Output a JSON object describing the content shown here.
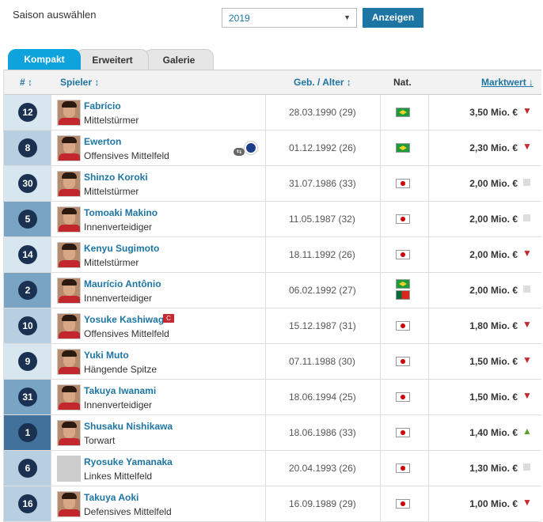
{
  "season": {
    "label": "Saison auswählen",
    "selected": "2019",
    "button": "Anzeigen"
  },
  "tabs": [
    "Kompakt",
    "Erweitert",
    "Galerie"
  ],
  "headers": {
    "num": "# ↕",
    "player": "Spieler ↕",
    "dob": "Geb. / Alter ↕",
    "nat": "Nat.",
    "mv": "Marktwert ↓"
  },
  "colors": {
    "accent": "#1d75a3",
    "tab_active": "#0fa3de",
    "down": "#c5282f",
    "up": "#5aa02c"
  },
  "players": [
    {
      "num": "12",
      "name": "Fabrício",
      "pos": "Mittelstürmer",
      "dob": "28.03.1990 (29)",
      "nat": [
        "br"
      ],
      "mv": "3,50 Mio. €",
      "trend": "down",
      "num_bg": "#d7e6ef"
    },
    {
      "num": "8",
      "name": "Ewerton",
      "pos": "Offensives Mittelfeld",
      "dob": "01.12.1992 (26)",
      "nat": [
        "br"
      ],
      "mv": "2,30 Mio. €",
      "trend": "down",
      "num_bg": "#b7cfe0",
      "loan": true
    },
    {
      "num": "30",
      "name": "Shinzo Koroki",
      "pos": "Mittelstürmer",
      "dob": "31.07.1986 (33)",
      "nat": [
        "jp"
      ],
      "mv": "2,00 Mio. €",
      "trend": "flat",
      "num_bg": "#d7e6ef"
    },
    {
      "num": "5",
      "name": "Tomoaki Makino",
      "pos": "Innenverteidiger",
      "dob": "11.05.1987 (32)",
      "nat": [
        "jp"
      ],
      "mv": "2,00 Mio. €",
      "trend": "flat",
      "num_bg": "#7aa4c3"
    },
    {
      "num": "14",
      "name": "Kenyu Sugimoto",
      "pos": "Mittelstürmer",
      "dob": "18.11.1992 (26)",
      "nat": [
        "jp"
      ],
      "mv": "2,00 Mio. €",
      "trend": "down",
      "num_bg": "#d7e6ef"
    },
    {
      "num": "2",
      "name": "Maurício Antônio",
      "pos": "Innenverteidiger",
      "dob": "06.02.1992 (27)",
      "nat": [
        "br",
        "pt"
      ],
      "mv": "2,00 Mio. €",
      "trend": "flat",
      "num_bg": "#7aa4c3"
    },
    {
      "num": "10",
      "name": "Yosuke Kashiwagi",
      "pos": "Offensives Mittelfeld",
      "dob": "15.12.1987 (31)",
      "nat": [
        "jp"
      ],
      "mv": "1,80 Mio. €",
      "trend": "down",
      "num_bg": "#b7cfe0",
      "captain": true
    },
    {
      "num": "9",
      "name": "Yuki Muto",
      "pos": "Hängende Spitze",
      "dob": "07.11.1988 (30)",
      "nat": [
        "jp"
      ],
      "mv": "1,50 Mio. €",
      "trend": "down",
      "num_bg": "#d7e6ef"
    },
    {
      "num": "31",
      "name": "Takuya Iwanami",
      "pos": "Innenverteidiger",
      "dob": "18.06.1994 (25)",
      "nat": [
        "jp"
      ],
      "mv": "1,50 Mio. €",
      "trend": "down",
      "num_bg": "#7aa4c3"
    },
    {
      "num": "1",
      "name": "Shusaku Nishikawa",
      "pos": "Torwart",
      "dob": "18.06.1986 (33)",
      "nat": [
        "jp"
      ],
      "mv": "1,40 Mio. €",
      "trend": "up",
      "num_bg": "#42719b"
    },
    {
      "num": "6",
      "name": "Ryosuke Yamanaka",
      "pos": "Linkes Mittelfeld",
      "dob": "20.04.1993 (26)",
      "nat": [
        "jp"
      ],
      "mv": "1,30 Mio. €",
      "trend": "flat",
      "num_bg": "#b7cfe0",
      "nophoto": true
    },
    {
      "num": "16",
      "name": "Takuya Aoki",
      "pos": "Defensives Mittelfeld",
      "dob": "16.09.1989 (29)",
      "nat": [
        "jp"
      ],
      "mv": "1,00 Mio. €",
      "trend": "down",
      "num_bg": "#b7cfe0"
    }
  ]
}
